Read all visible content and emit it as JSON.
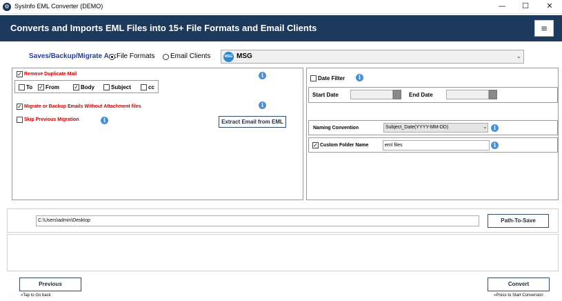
{
  "window": {
    "title": "SysInfo EML Converter (DEMO)",
    "minimize": "—",
    "maximize": "☐",
    "close": "✕"
  },
  "header": {
    "title": "Converts and Imports EML Files into 15+ File Formats and Email Clients",
    "menu_icon": "≡"
  },
  "saves": {
    "label": "Saves/Backup/Migrate As :",
    "options": [
      {
        "label": "File Formats",
        "selected": true
      },
      {
        "label": "Email Clients",
        "selected": false
      }
    ],
    "format_badge": "MSG",
    "format_value": "MSG"
  },
  "left_panel": {
    "remove_duplicate": {
      "label": "Remove Duplicate Mail",
      "checked": true
    },
    "dup_fields": [
      {
        "label": "To",
        "checked": false
      },
      {
        "label": "From",
        "checked": true
      },
      {
        "label": "Body",
        "checked": true
      },
      {
        "label": "Subject",
        "checked": false
      },
      {
        "label": "cc",
        "checked": false
      }
    ],
    "migrate_without_attachment": {
      "label": "Migrate or Backup Emails Without Attachment files",
      "checked": true
    },
    "skip_previous": {
      "label": "Skip Previous Migration",
      "checked": false
    },
    "extract_button": "Extract Email from EML"
  },
  "right_panel": {
    "date_filter": {
      "label": "Date Filter",
      "checked": false
    },
    "start_date_label": "Start Date",
    "end_date_label": "End Date",
    "naming_convention_label": "Naming Convention",
    "naming_convention_value": "Subject_Date(YYYY-MM-DD)",
    "custom_folder": {
      "label": "Custom Folder Name",
      "checked": true
    },
    "custom_folder_value": "eml files"
  },
  "path": {
    "value": "C:\\Users\\admin\\Desktop",
    "button": "Path-To-Save"
  },
  "footer": {
    "previous_button": "Previous",
    "previous_hint": "»Tap to Go back",
    "convert_button": "Convert",
    "convert_hint": "»Press to Start Conversion"
  },
  "colors": {
    "banner": "#1d3a5c",
    "accent_label": "#1f3f9c",
    "warning_label": "#c40000",
    "info_icon": "#4a8fd6"
  }
}
